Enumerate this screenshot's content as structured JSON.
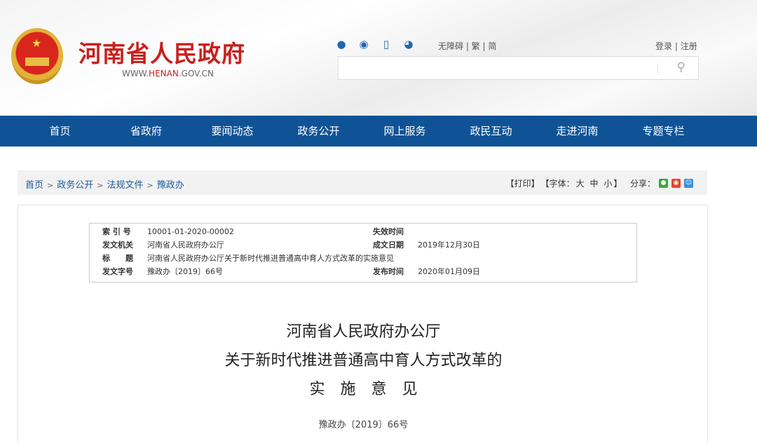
{
  "header": {
    "site_title": "河南省人民政府",
    "url_prefix": "WWW.",
    "url_mid": "HENAN",
    "url_suffix": ".GOV.CN",
    "a11y": "无障碍",
    "trad": "繁",
    "simp": "简",
    "login": "登录",
    "register": "注册",
    "search_placeholder": ""
  },
  "nav": [
    "首页",
    "省政府",
    "要闻动态",
    "政务公开",
    "网上服务",
    "政民互动",
    "走进河南",
    "专题专栏"
  ],
  "breadcrumb": [
    "首页",
    "政务公开",
    "法规文件",
    "豫政办"
  ],
  "tools": {
    "print": "【打印】",
    "font": "【字体：",
    "large": "大",
    "medium": "中",
    "small": "小",
    "font_end": "】",
    "share": "分享："
  },
  "meta": {
    "index_label": "索 引 号",
    "index": "10001-01-2020-00002",
    "expire_label": "失效时间",
    "expire": "",
    "issuer_label": "发文机关",
    "issuer": "河南省人民政府办公厅",
    "date_label": "成文日期",
    "date": "2019年12月30日",
    "title_label": "标　　题",
    "title": "河南省人民政府办公厅关于新时代推进普通高中育人方式改革的实施意见",
    "docno_label": "发文字号",
    "docno": "豫政办〔2019〕66号",
    "publish_label": "发布时间",
    "publish": "2020年01月09日"
  },
  "document": {
    "title_line1": "河南省人民政府办公厅",
    "title_line2": "关于新时代推进普通高中育人方式改革的",
    "title_line3": "实　施　意　见",
    "doc_number": "豫政办〔2019〕66号"
  }
}
